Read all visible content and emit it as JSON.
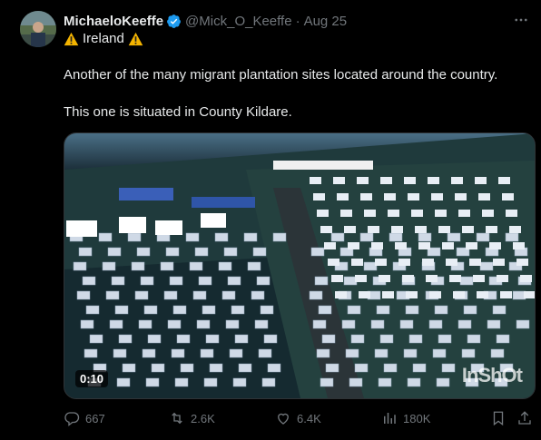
{
  "tweet": {
    "author_name": "MichaeloKeeffe",
    "handle": "@Mick_O_Keeffe",
    "separator": "·",
    "date": "Aug 25",
    "location": "Ireland",
    "line1": "Another of the many migrant plantation sites located around the country.",
    "line2": "This one is situated in County Kildare."
  },
  "media": {
    "duration": "0:10",
    "watermark": "InShOt"
  },
  "actions": {
    "replies": "667",
    "reposts": "2.6K",
    "likes": "6.4K",
    "views": "180K"
  },
  "colors": {
    "background": "#000000",
    "text": "#e7e9ea",
    "muted": "#71767b",
    "verified": "#1d9bf0",
    "warning": "#f4b400"
  },
  "icons": [
    "verified-badge-icon",
    "warning-icon",
    "more-icon",
    "reply-icon",
    "retweet-icon",
    "like-icon",
    "views-icon",
    "bookmark-icon",
    "share-icon",
    "play-video"
  ]
}
